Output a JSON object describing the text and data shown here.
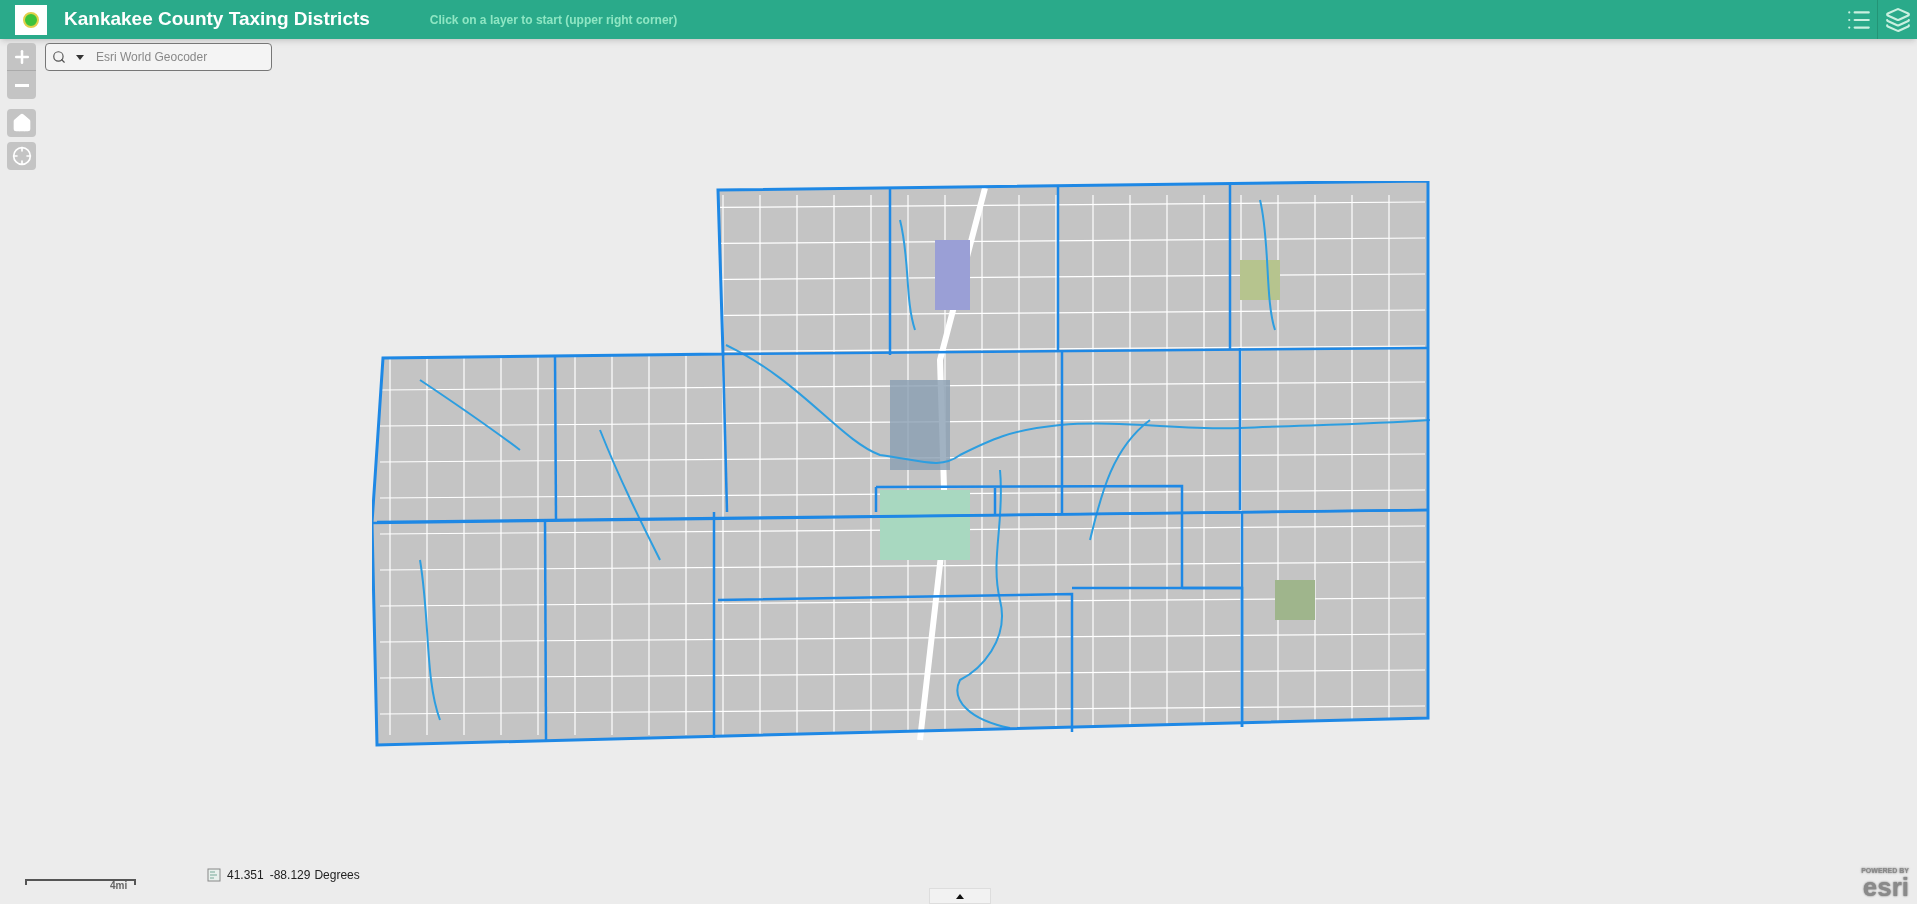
{
  "header": {
    "title": "Kankakee County Taxing Districts",
    "hint": "Click on a layer to start (upper right corner)"
  },
  "search": {
    "placeholder": "Esri World Geocoder"
  },
  "scale_bar": {
    "label": "4mi"
  },
  "coordinates": {
    "latitude": "41.351",
    "longitude": "-88.129",
    "unit": "Degrees"
  },
  "attribution": {
    "caption": "POWERED BY",
    "logo": "esri"
  }
}
